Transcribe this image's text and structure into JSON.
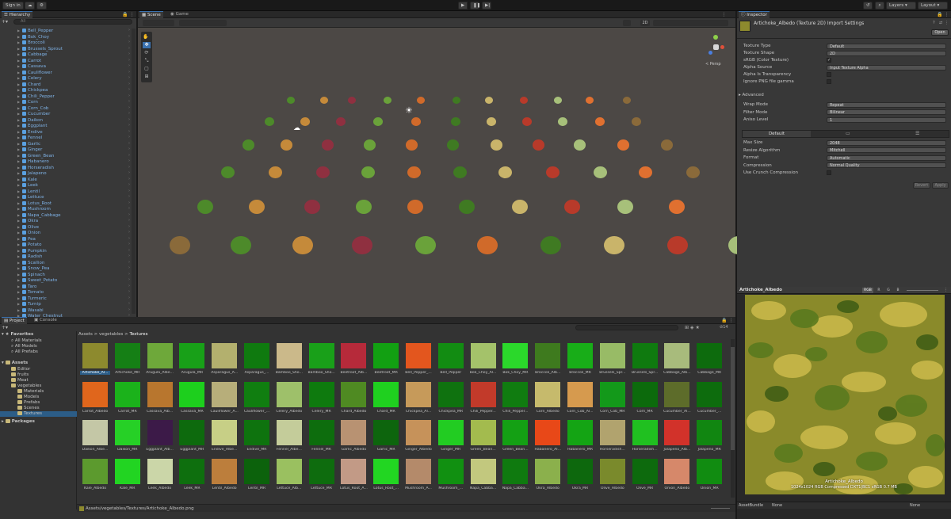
{
  "toolbar": {
    "sign_in": "Sign in",
    "layers": "Layers",
    "layout": "Layout"
  },
  "hierarchy": {
    "title": "Hierarchy",
    "search_placeholder": "All",
    "items": [
      "Bell_Pepper",
      "Bok_Choy",
      "Broccoli",
      "Brussels_Sprout",
      "Cabbage",
      "Carrot",
      "Cassava",
      "Cauliflower",
      "Celery",
      "Chard",
      "Chickpea",
      "Chili_Pepper",
      "Corn",
      "Corn_Cob",
      "Cucumber",
      "Daikon",
      "Eggplant",
      "Endive",
      "Fennel",
      "Garlic",
      "Ginger",
      "Green_Bean",
      "Habanero",
      "Horseradish",
      "Jalapeno",
      "Kale",
      "Leek",
      "Lentil",
      "Lettuce",
      "Lotus_Root",
      "Mushroom",
      "Napa_Cabbage",
      "Okra",
      "Olive",
      "Onion",
      "Pea",
      "Potato",
      "Pumpkin",
      "Radish",
      "Scallion",
      "Snow_Pea",
      "Spinach",
      "Sweet_Potato",
      "Taro",
      "Tomato",
      "Turmeric",
      "Turnip",
      "Wasabi",
      "Water_Chestnut"
    ]
  },
  "scene": {
    "tabs": [
      "Scene",
      "Game"
    ],
    "mode_2d": "2D",
    "persp": "< Persp"
  },
  "inspector": {
    "title": "Inspector",
    "asset_title": "Artichoke_Albedo (Texture 2D) Import Settings",
    "open_label": "Open",
    "rows": [
      {
        "label": "Texture Type",
        "value": "Default"
      },
      {
        "label": "Texture Shape",
        "value": "2D"
      },
      {
        "label": "sRGB (Color Texture)",
        "value": "✓"
      },
      {
        "label": "Alpha Source",
        "value": "Input Texture Alpha"
      },
      {
        "label": "Alpha Is Transparency",
        "value": ""
      },
      {
        "label": "Ignore PNG file gamma",
        "value": ""
      }
    ],
    "advanced": "Advanced",
    "rows2": [
      {
        "label": "Wrap Mode",
        "value": "Repeat"
      },
      {
        "label": "Filter Mode",
        "value": "Bilinear"
      },
      {
        "label": "Aniso Level",
        "value": "1"
      }
    ],
    "platform_default": "Default",
    "rows3": [
      {
        "label": "Max Size",
        "value": "2048"
      },
      {
        "label": "Resize Algorithm",
        "value": "Mitchell"
      },
      {
        "label": "Format",
        "value": "Automatic"
      },
      {
        "label": "Compression",
        "value": "Normal Quality"
      },
      {
        "label": "Use Crunch Compression",
        "value": ""
      }
    ],
    "revert": "Revert",
    "apply": "Apply"
  },
  "preview": {
    "title": "Artichoke_Albedo",
    "channels": [
      "RGB",
      "R",
      "G",
      "B"
    ],
    "caption_name": "Artichoke_Albedo",
    "caption_info": "1024x1024  RGB Compressed DXT1|BC1 sRGB  0.7 MB",
    "assetbundle_label": "AssetBundle",
    "assetbundle_value": "None",
    "variant_value": "None"
  },
  "project": {
    "tabs": [
      "Project",
      "Console"
    ],
    "favorites": "Favorites",
    "fav_items": [
      "All Materials",
      "All Models",
      "All Prefabs"
    ],
    "assets": "Assets",
    "asset_folders": [
      "Editor",
      "fruits",
      "Meat",
      "vegetables",
      "Materials",
      "Models",
      "Prefabs",
      "Scenes",
      "Textures"
    ],
    "packages": "Packages",
    "breadcrumb": [
      "Assets",
      "vegetables",
      "Textures"
    ],
    "count": "14",
    "status_path": "Assets/vegetables/Textures/Artichoke_Albedo.png",
    "assets_grid": [
      {
        "name": "Artichoke_Al...",
        "color": "#8d8a2e"
      },
      {
        "name": "Artichoke_MR",
        "color": "#157f15"
      },
      {
        "name": "Arugula_Albe...",
        "color": "#6ea83a"
      },
      {
        "name": "Arugula_MR",
        "color": "#18a018"
      },
      {
        "name": "Asparagus_A...",
        "color": "#b3b06e"
      },
      {
        "name": "Asparagus_...",
        "color": "#0f7a0f"
      },
      {
        "name": "Bamboo_Sho...",
        "color": "#cbb98a"
      },
      {
        "name": "Bamboo_Sho...",
        "color": "#19a019"
      },
      {
        "name": "Beetroot_Alb...",
        "color": "#b62a3a"
      },
      {
        "name": "Beetroot_MR",
        "color": "#12a012"
      },
      {
        "name": "Bell_Pepper_...",
        "color": "#e3561e"
      },
      {
        "name": "Bell_Pepper",
        "color": "#128c12"
      },
      {
        "name": "Bok_Choy_Al...",
        "color": "#a4c26a"
      },
      {
        "name": "Bok_Choy_MR",
        "color": "#2bd82b"
      },
      {
        "name": "Broccoli_Alb...",
        "color": "#3e7a1e"
      },
      {
        "name": "Broccoli_MR",
        "color": "#18ad18"
      },
      {
        "name": "Brussels_Spr...",
        "color": "#98bb66"
      },
      {
        "name": "Brussels_Spr...",
        "color": "#0f7a0f"
      },
      {
        "name": "Cabbage_Alb...",
        "color": "#a8bb7c"
      },
      {
        "name": "Cabbage_MR",
        "color": "#0d6b0d"
      },
      {
        "name": "Carrot_Albedo",
        "color": "#e0661c"
      },
      {
        "name": "Carrot_MR",
        "color": "#1bb21b"
      },
      {
        "name": "Cassava_Alb...",
        "color": "#b8762e"
      },
      {
        "name": "Cassava_MR",
        "color": "#1dcf1d"
      },
      {
        "name": "Cauliflower_A...",
        "color": "#b7ae7a"
      },
      {
        "name": "Cauliflower_...",
        "color": "#107e10"
      },
      {
        "name": "Celery_Albedo",
        "color": "#9ec06a"
      },
      {
        "name": "Celery_MR",
        "color": "#0e7a0e"
      },
      {
        "name": "Chard_Albedo",
        "color": "#4f8a22"
      },
      {
        "name": "Chard_MR",
        "color": "#1fd01f"
      },
      {
        "name": "Chickpea_Al...",
        "color": "#c69a5a"
      },
      {
        "name": "Chickpea_MR",
        "color": "#0f720f"
      },
      {
        "name": "Chili_Pepper...",
        "color": "#c23a2a"
      },
      {
        "name": "Chili_Pepper...",
        "color": "#107c10"
      },
      {
        "name": "Corn_Albedo",
        "color": "#c6ba6c"
      },
      {
        "name": "Corn_Cob_Al...",
        "color": "#d69a4e"
      },
      {
        "name": "Corn_Cob_MR",
        "color": "#13991a"
      },
      {
        "name": "Corn_MR",
        "color": "#0c6a0c"
      },
      {
        "name": "Cucumber_Al...",
        "color": "#5d6c2a"
      },
      {
        "name": "Cucumber_...",
        "color": "#0d6c0d"
      },
      {
        "name": "Daikon_Albe...",
        "color": "#c4c7a6"
      },
      {
        "name": "Daikon_MR",
        "color": "#26d026"
      },
      {
        "name": "Eggplant_Alb...",
        "color": "#3c1a48"
      },
      {
        "name": "Eggplant_MR",
        "color": "#0d6a0d"
      },
      {
        "name": "Endive_Albe...",
        "color": "#c7cf86"
      },
      {
        "name": "Endive_MR",
        "color": "#0e730e"
      },
      {
        "name": "Fennel_Albe...",
        "color": "#c4cc9a"
      },
      {
        "name": "Fennel_MR",
        "color": "#0d6d0d"
      },
      {
        "name": "Garlic_Albedo",
        "color": "#b89272"
      },
      {
        "name": "Garlic_MR",
        "color": "#0d650d"
      },
      {
        "name": "Ginger_Albedo",
        "color": "#c6925a"
      },
      {
        "name": "Ginger_MR",
        "color": "#22cc22"
      },
      {
        "name": "Green_Bean...",
        "color": "#a3bb4e"
      },
      {
        "name": "Green_Bean...",
        "color": "#14a014"
      },
      {
        "name": "Habanero_Al...",
        "color": "#e84818"
      },
      {
        "name": "Habanero_MR",
        "color": "#14a414"
      },
      {
        "name": "Horseradish...",
        "color": "#b1a36e"
      },
      {
        "name": "Horseradish...",
        "color": "#20c020"
      },
      {
        "name": "Jalapeno_Alb...",
        "color": "#d2322a"
      },
      {
        "name": "Jalapeno_MR",
        "color": "#118611"
      },
      {
        "name": "Kale_Albedo",
        "color": "#5c9a2e"
      },
      {
        "name": "Kale_MR",
        "color": "#22d422"
      },
      {
        "name": "Leek_Albedo",
        "color": "#cbd6a8"
      },
      {
        "name": "Leek_MR",
        "color": "#0e6f0e"
      },
      {
        "name": "Lentil_Albedo",
        "color": "#bc7e3c"
      },
      {
        "name": "Lentil_MR",
        "color": "#0c620c"
      },
      {
        "name": "Lettuce_Alb...",
        "color": "#9ac060"
      },
      {
        "name": "Lettuce_MR",
        "color": "#0e6c0e"
      },
      {
        "name": "Lotus_Root_A...",
        "color": "#c29a86"
      },
      {
        "name": "Lotus_Root_...",
        "color": "#22d622"
      },
      {
        "name": "Mushroom_A...",
        "color": "#b48a6a"
      },
      {
        "name": "Mushroom_...",
        "color": "#119011"
      },
      {
        "name": "Napa_Cabba...",
        "color": "#c2c87e"
      },
      {
        "name": "Napa_Cabba...",
        "color": "#0f7a0f"
      },
      {
        "name": "Okra_Albedo",
        "color": "#8bb04c"
      },
      {
        "name": "Okra_MR",
        "color": "#0d680d"
      },
      {
        "name": "Olive_Albedo",
        "color": "#7a8a2c"
      },
      {
        "name": "Olive_MR",
        "color": "#0d6a0d"
      },
      {
        "name": "Onion_Albedo",
        "color": "#d6886a"
      },
      {
        "name": "Onion_MR",
        "color": "#118c11"
      }
    ]
  }
}
